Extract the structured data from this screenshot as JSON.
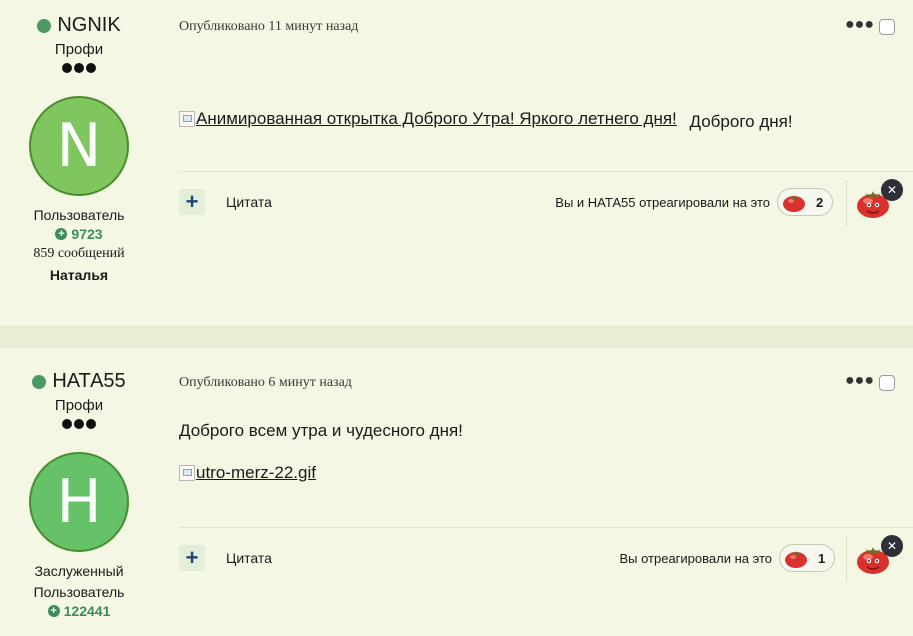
{
  "posts": [
    {
      "author": {
        "name": "NGNIK",
        "rank": "Профи",
        "avatar_letter": "N",
        "group": "Пользователь",
        "reputation": "9723",
        "posts_count": "859 сообщений",
        "real_name": "Наталья"
      },
      "meta": "Опубликовано 11 минут назад",
      "content": {
        "image_alt": "Анимированная открытка Доброго Утра! Яркого летнего дня!",
        "text": "Доброго дня!"
      },
      "quote_label": "Цитата",
      "reactions_text": "Вы и НАТА55 отреагировали на это",
      "reaction_count": "2"
    },
    {
      "author": {
        "name": "НАТА55",
        "rank": "Профи",
        "avatar_letter": "H",
        "group_line1": "Заслуженный",
        "group_line2": "Пользователь",
        "reputation": "122441"
      },
      "meta": "Опубликовано 6 минут назад",
      "content": {
        "text": "Доброго всем утра и чудесного дня!",
        "image_alt": "utro-merz-22.gif"
      },
      "quote_label": "Цитата",
      "reactions_text": "Вы отреагировали на это",
      "reaction_count": "1"
    }
  ],
  "icons": {
    "more": "more-options-icon",
    "reaction": "tomato-reaction-icon",
    "close": "close-icon",
    "broken_image": "broken-image-icon"
  },
  "colors": {
    "background": "#f3f7e3",
    "online": "#4a9a62",
    "reputation": "#3d8b5a",
    "quote_button_bg": "#e3eed9"
  }
}
